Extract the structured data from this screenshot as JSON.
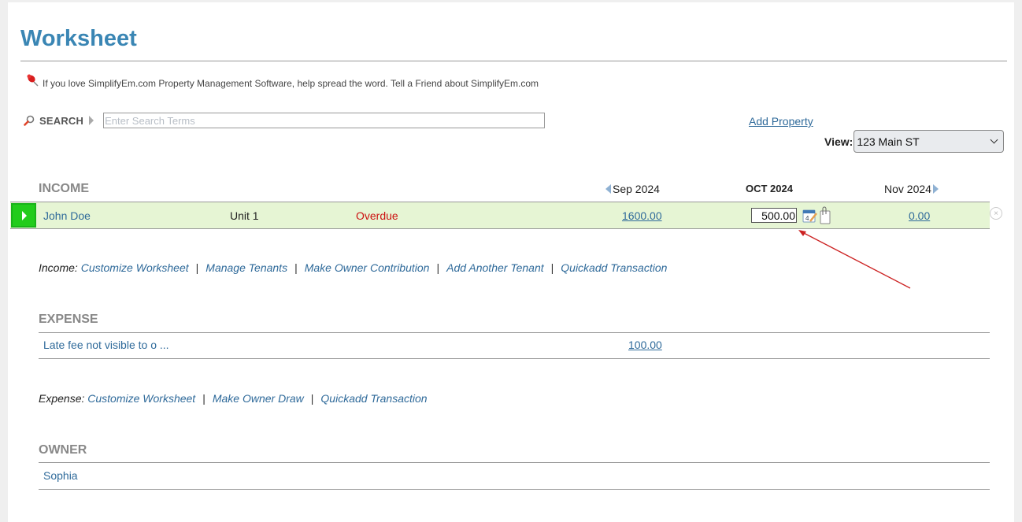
{
  "page": {
    "title": "Worksheet",
    "promo_text": "If you love SimplifyEm.com Property Management Software, help spread the word. Tell a Friend about SimplifyEm.com"
  },
  "search": {
    "label": "SEARCH",
    "placeholder": "Enter Search Terms",
    "value": ""
  },
  "header_actions": {
    "add_property": "Add Property",
    "view_label": "View:",
    "view_selected": "123 Main ST"
  },
  "months": {
    "prev": "Sep 2024",
    "current": "OCT 2024",
    "next": "Nov 2024"
  },
  "income": {
    "heading": "INCOME",
    "rows": [
      {
        "tenant": "John Doe",
        "unit": "Unit 1",
        "status": "Overdue",
        "prev_amount": "1600.00",
        "current_amount": "500.00",
        "attachment_count": "0",
        "next_amount": "0.00"
      }
    ],
    "links_label": "Income:",
    "links": [
      "Customize Worksheet",
      "Manage Tenants",
      "Make Owner Contribution",
      "Add Another Tenant",
      "Quickadd Transaction"
    ],
    "separator": "|"
  },
  "expense": {
    "heading": "EXPENSE",
    "rows": [
      {
        "description": "Late fee not visible to o ...",
        "prev_amount": "100.00"
      }
    ],
    "links_label": "Expense:",
    "links": [
      "Customize Worksheet",
      "Make Owner Draw",
      "Quickadd Transaction"
    ],
    "separator": "|"
  },
  "owner": {
    "heading": "OWNER",
    "rows": [
      {
        "name": "Sophia"
      }
    ]
  },
  "colors": {
    "title": "#3a86b4",
    "link": "#2f6a9a",
    "overdue": "#cc1111",
    "row_highlight": "#e6f5d4",
    "play_button": "#22cc1b",
    "annotation_arrow": "#cc2222"
  },
  "icons": {
    "pin": "pushpin-icon",
    "search": "magnifier-icon",
    "calendar": "calendar-edit-icon",
    "attachment": "paperclip-document-icon",
    "remove": "close-circle-icon",
    "expand": "play-arrow-icon"
  }
}
